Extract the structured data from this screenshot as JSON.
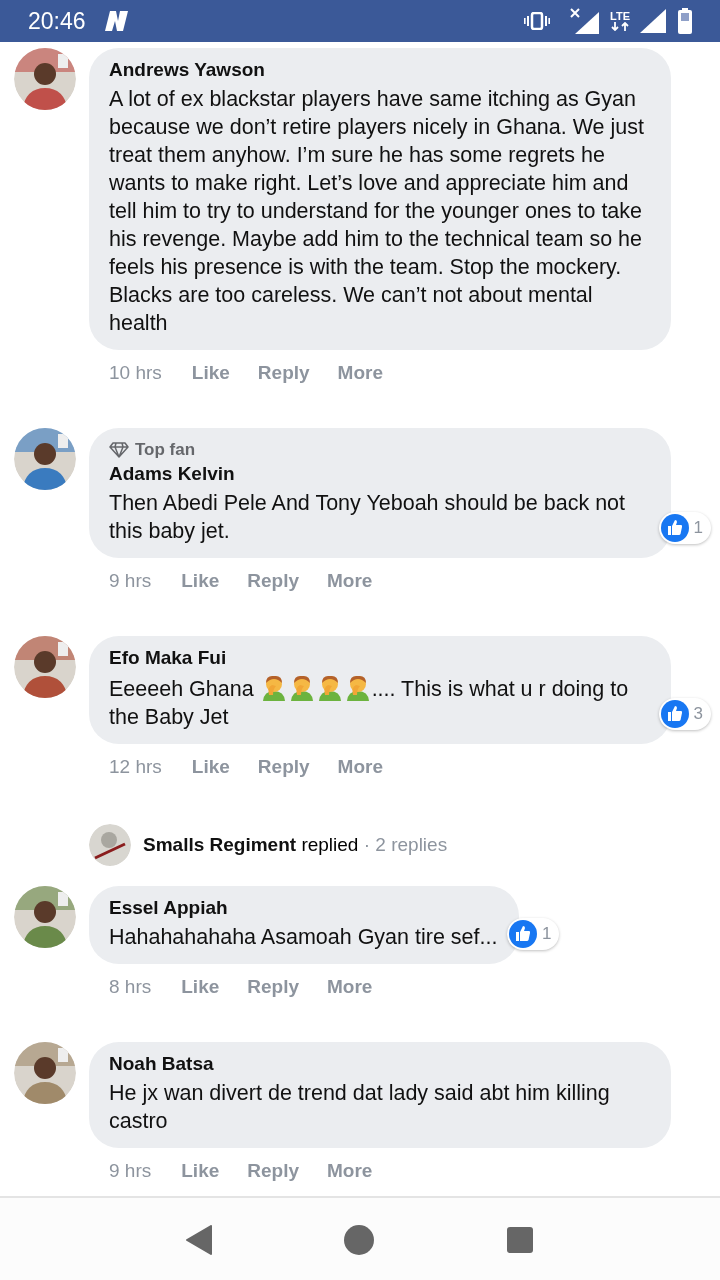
{
  "status_bar": {
    "time": "20:46",
    "lte": "LTE"
  },
  "comments": [
    {
      "name": "Andrews Yawson",
      "body": [
        {
          "kind": "text",
          "text": "A lot of ex blackstar players have same itching as Gyan because we don’t retire players nicely in Ghana. We just treat them anyhow. I’m sure he has some regrets he wants to make right. Let’s love and appreciate him and tell him to try to understand for the younger ones to take his revenge. Maybe add him to the technical team so he feels his presence is with the team. Stop the mockery. Blacks are too careless. We can’t not about mental health"
        }
      ],
      "time": "10 hrs",
      "actions": [
        "Like",
        "Reply",
        "More"
      ]
    },
    {
      "name": "Adams Kelvin",
      "badge": "Top fan",
      "body": [
        {
          "kind": "text",
          "text": "Then Abedi Pele And Tony Yeboah should be back not this baby jet."
        }
      ],
      "reactions": "1",
      "time": "9 hrs",
      "actions": [
        "Like",
        "Reply",
        "More"
      ]
    },
    {
      "name": "Efo Maka Fui",
      "body": [
        {
          "kind": "text",
          "text": "Eeeeeh Ghana "
        },
        {
          "kind": "emoji"
        },
        {
          "kind": "emoji"
        },
        {
          "kind": "emoji"
        },
        {
          "kind": "emoji"
        },
        {
          "kind": "text",
          "text": ".... This is what u r doing to the Baby Jet"
        }
      ],
      "reactions": "3",
      "time": "12 hrs",
      "actions": [
        "Like",
        "Reply",
        "More"
      ],
      "replies": {
        "name": "Smalls Regiment",
        "verb": "replied",
        "count": "· 2 replies"
      }
    },
    {
      "name": "Essel Appiah",
      "body": [
        {
          "kind": "text",
          "text": "Hahahahahaha Asamoah Gyan tire sef..."
        }
      ],
      "reactions": "1",
      "time": "8 hrs",
      "actions": [
        "Like",
        "Reply",
        "More"
      ]
    },
    {
      "name": "Noah Batsa",
      "body": [
        {
          "kind": "text",
          "text": "He jx wan divert de trend dat lady said abt him killing castro"
        }
      ],
      "time": "9 hrs",
      "actions": [
        "Like",
        "Reply",
        "More"
      ]
    }
  ]
}
